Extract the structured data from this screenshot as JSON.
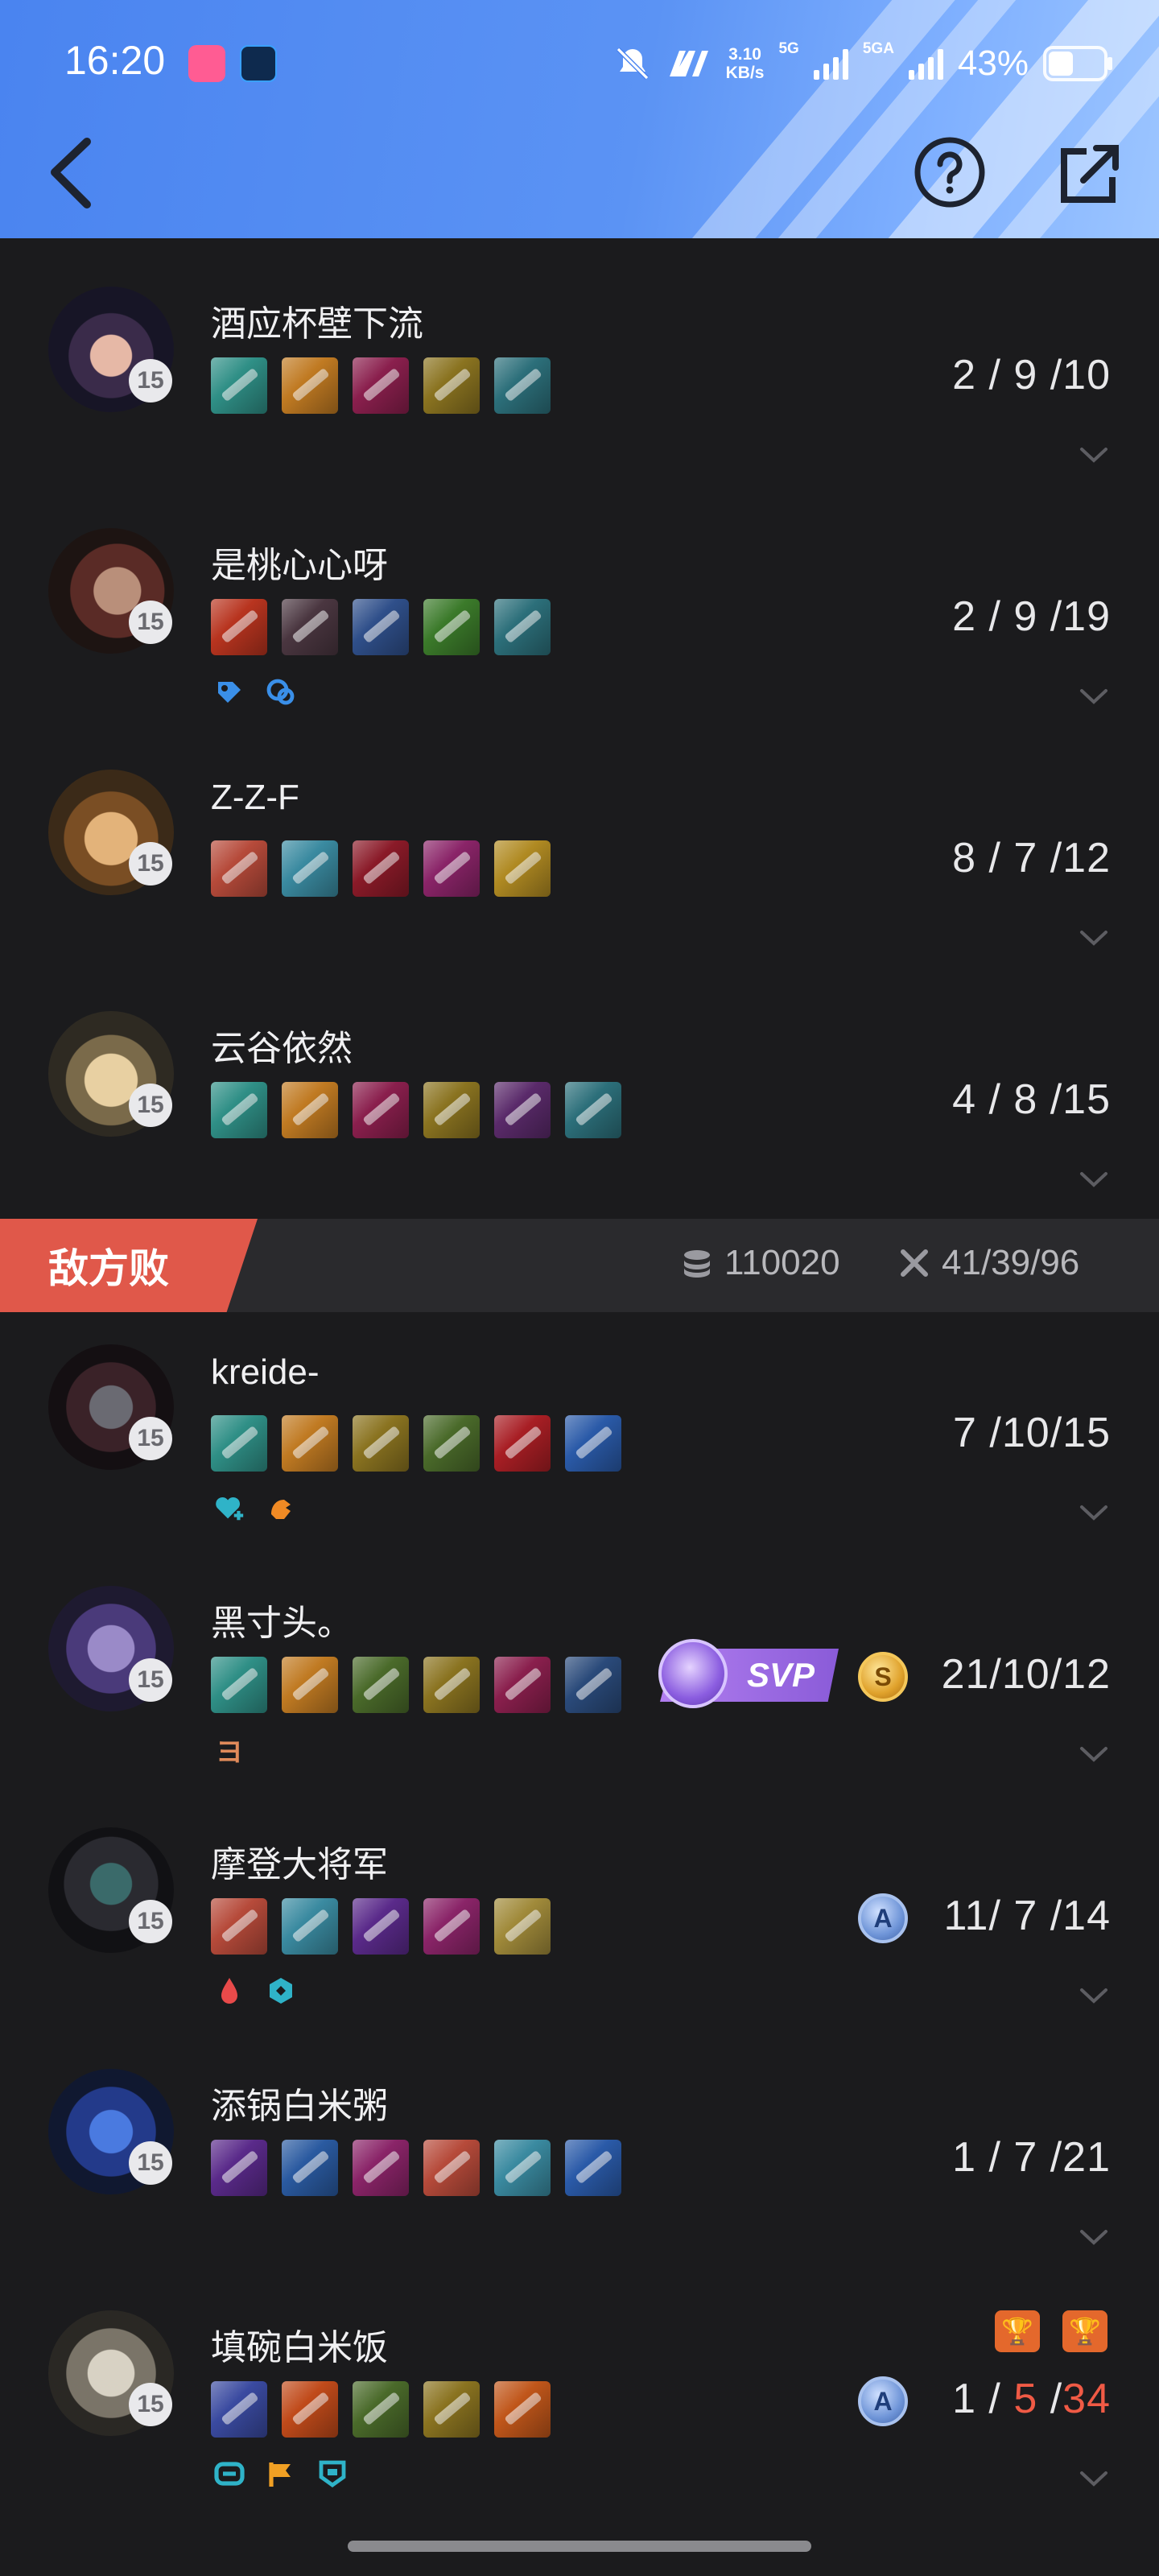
{
  "status_bar": {
    "time": "16:20",
    "net_speed_value": "3.10",
    "net_speed_unit": "KB/s",
    "sig1_label": "5G",
    "sig2_label": "5GA",
    "battery": "43%"
  },
  "nav": {
    "back_icon": "back-arrow-icon",
    "help_icon": "question-circle-icon",
    "share_icon": "share-external-icon"
  },
  "ally_players": [
    {
      "name": "酒应杯壁下流",
      "level": "15",
      "kda": "2 / 9 /10"
    },
    {
      "name": "是桃心心呀",
      "level": "15",
      "kda": "2 / 9 /19"
    },
    {
      "name": "Z-Z-F",
      "level": "15",
      "kda": "8 / 7 /12"
    },
    {
      "name": "云谷依然",
      "level": "15",
      "kda": "4 / 8 /15"
    }
  ],
  "enemy_team": {
    "label": "敌方败",
    "gold": "110020",
    "kda_total": "41/39/96"
  },
  "enemy_players": [
    {
      "name": "kreide-",
      "level": "15",
      "kda": "7 /10/15"
    },
    {
      "name": "黑寸头。",
      "level": "15",
      "kda": "21/10/12",
      "badge_text": "SVP",
      "tag_text": "ヨ"
    },
    {
      "name": "摩登大将军",
      "level": "15",
      "kda": "11/ 7 /14",
      "badge_letter": "A"
    },
    {
      "name": "添锅白米粥",
      "level": "15",
      "kda": "1 / 7 /21"
    },
    {
      "name": "填碗白米饭",
      "level": "15",
      "kda_k": "1",
      "kda_d": "5",
      "kda_a": "34",
      "badge_letter": "A"
    }
  ],
  "badge_s_letter": "S",
  "colors": {
    "header": "#5b93f4",
    "bg": "#1b1b1d",
    "defeat": "#e0584a",
    "accent_red": "#f05a45"
  }
}
